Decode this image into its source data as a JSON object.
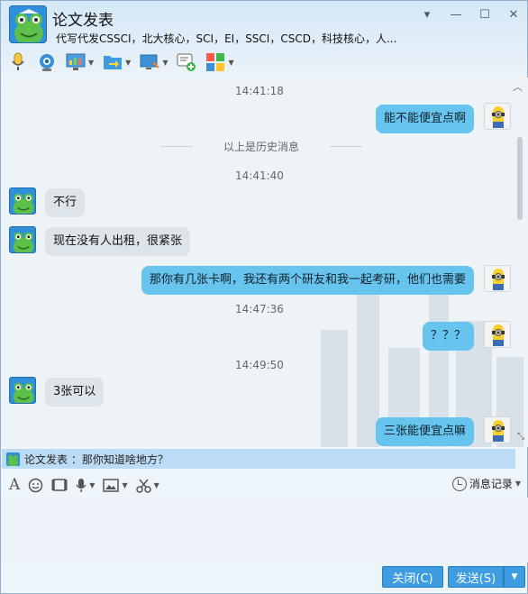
{
  "header": {
    "name": "论文发表",
    "signature": "代写代发CSSCI，北大核心，SCI，EI，SSCI，CSCD，科技核心，人..."
  },
  "window_controls": {
    "menu": "▾",
    "minimize": "—",
    "maximize": "☐",
    "close": "✕"
  },
  "toolbar": [
    {
      "name": "voice-call",
      "icon": "microphone-icon"
    },
    {
      "name": "video-call",
      "icon": "webcam-icon"
    },
    {
      "name": "remote-assist",
      "icon": "screen-chart-icon"
    },
    {
      "name": "send-file",
      "icon": "folder-arrow-icon"
    },
    {
      "name": "share-screen",
      "icon": "monitor-share-icon"
    },
    {
      "name": "create-group",
      "icon": "chat-add-icon"
    },
    {
      "name": "apps",
      "icon": "apps-grid-icon"
    }
  ],
  "chat": {
    "history_label": "以上是历史消息",
    "timestamps": [
      "14:41:18",
      "14:41:40",
      "14:47:36",
      "14:49:50"
    ],
    "messages": [
      {
        "side": "out",
        "text": "能不能便宜点啊"
      },
      {
        "side": "in",
        "text": "不行"
      },
      {
        "side": "in",
        "text": "现在没有人出租，很紧张"
      },
      {
        "side": "out",
        "text": "那你有几张卡啊，我还有两个研友和我一起考研，他们也需要"
      },
      {
        "side": "out",
        "text": "？？？"
      },
      {
        "side": "in",
        "text": "3张可以"
      },
      {
        "side": "out",
        "text": "三张能便宜点嘛"
      }
    ]
  },
  "notice": {
    "text": "论文发表 ：那你知道啥地方？"
  },
  "input_toolbar": {
    "history_label": "消息记录"
  },
  "buttons": {
    "close": "关闭(C)",
    "send": "发送(S)",
    "send_drop": "▼"
  },
  "colors": {
    "bubble_out": "#67c4ee",
    "bubble_in": "#dde4ea",
    "button": "#3e9ce0",
    "notice": "#bcdcf5"
  }
}
